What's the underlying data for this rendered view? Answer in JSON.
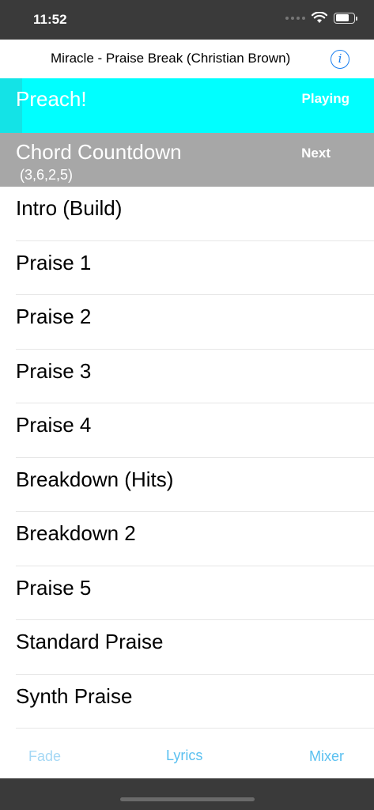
{
  "status_bar": {
    "time": "11:52",
    "wifi_icon": "wifi-icon",
    "battery_level": 0.75
  },
  "header": {
    "title": "Miracle - Praise Break (Christian Brown)",
    "info_icon": "info-icon",
    "info_glyph": "i"
  },
  "now_playing": {
    "label": "Preach!",
    "state": "Playing",
    "progress": 0.06,
    "color": "#00ffff"
  },
  "up_next": {
    "label": "Chord Countdown",
    "chords": "(3,6,2,5)",
    "state": "Next",
    "color": "#a7a7a7"
  },
  "sections": [
    "Intro (Build)",
    "Praise 1",
    "Praise 2",
    "Praise 3",
    "Praise 4",
    "Breakdown (Hits)",
    "Breakdown 2",
    "Praise 5",
    "Standard Praise",
    "Synth Praise"
  ],
  "toolbar": {
    "fade_label": "Fade",
    "lyrics_label": "Lyrics",
    "mixer_label": "Mixer",
    "accent": "#5ac0f0"
  }
}
